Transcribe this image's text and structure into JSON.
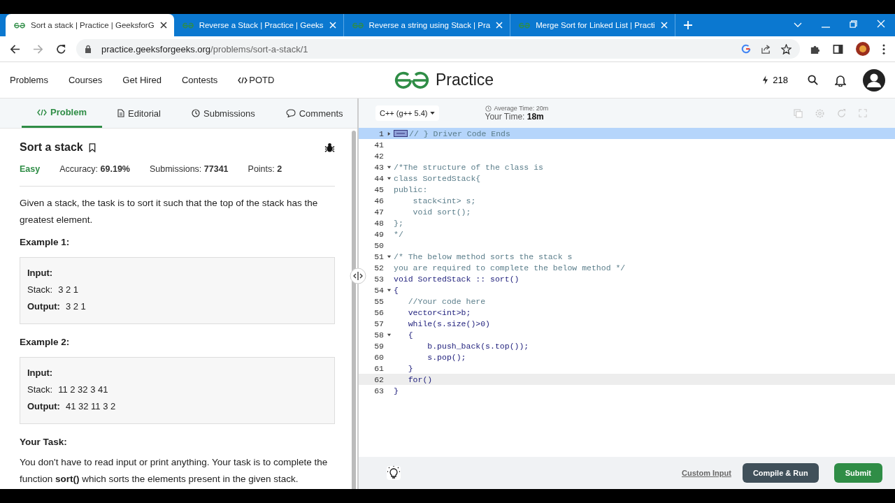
{
  "browser": {
    "tabs": [
      {
        "title": "Sort a stack | Practice | GeeksforG",
        "selected": true
      },
      {
        "title": "Reverse a Stack | Practice | Geeks",
        "selected": false
      },
      {
        "title": "Reverse a string using Stack | Pra",
        "selected": false
      },
      {
        "title": "Merge Sort for Linked List | Practi",
        "selected": false
      }
    ],
    "url": {
      "domain": "practice.geeksforgeeks.org",
      "path": "/problems/sort-a-stack/1"
    }
  },
  "site_nav": {
    "items": [
      "Problems",
      "Courses",
      "Get Hired",
      "Contests",
      "POTD"
    ],
    "logo": "Practice",
    "streak": "218"
  },
  "problem_tabs": [
    {
      "label": "Problem",
      "selected": true
    },
    {
      "label": "Editorial",
      "selected": false
    },
    {
      "label": "Submissions",
      "selected": false
    },
    {
      "label": "Comments",
      "selected": false
    }
  ],
  "problem": {
    "title": "Sort a stack",
    "difficulty": "Easy",
    "stats": [
      "Accuracy: **69.19%**",
      "Submissions: **77341**",
      "Points: **2**"
    ],
    "description": "Given a stack, the task is to sort it such that the top of the stack has the greatest element.",
    "examples": [
      {
        "title": "Example 1:",
        "lines": [
          {
            "label": "Input:"
          },
          {
            "label": "Stack:",
            "value": "3 2 1"
          },
          {
            "label": "Output:",
            "value": "3 2 1"
          }
        ]
      },
      {
        "title": "Example 2:",
        "lines": [
          {
            "label": "Input:"
          },
          {
            "label": "Stack:",
            "value": "11 2 32 3 41"
          },
          {
            "label": "Output:",
            "value": "41 32 11 3 2"
          }
        ]
      }
    ],
    "task_heading": "Your Task:",
    "task_text": "You don't have to read input or print anything. Your task is to complete the function **sort()** which sorts the elements present in the given stack."
  },
  "editor": {
    "language": "C++ (g++ 5.4)",
    "average_time": "Average Time: 20m",
    "your_time_label": "Your Time:",
    "your_time": "18m",
    "lines": [
      {
        "number": "1",
        "text": "// } Driver Code Ends",
        "kind": "comment",
        "foldable": true,
        "collapsed": true,
        "selected": true,
        "active": false
      },
      {
        "number": "41",
        "foldable": false,
        "collapsed": false,
        "selected": false,
        "active": false
      },
      {
        "number": "42",
        "foldable": false,
        "collapsed": false,
        "selected": false,
        "active": false
      },
      {
        "number": "43",
        "text": "/*The structure of the class is",
        "kind": "comment",
        "foldable": true,
        "collapsed": false,
        "selected": false,
        "active": false
      },
      {
        "number": "44",
        "text": "class SortedStack{",
        "kind": "comment",
        "foldable": true,
        "collapsed": false,
        "selected": false,
        "active": false
      },
      {
        "number": "45",
        "text": "public:",
        "kind": "comment",
        "foldable": false,
        "collapsed": false,
        "selected": false,
        "active": false
      },
      {
        "number": "46",
        "text": "    stack<int> s;",
        "kind": "comment",
        "foldable": false,
        "collapsed": false,
        "selected": false,
        "active": false
      },
      {
        "number": "47",
        "text": "    void sort();",
        "kind": "comment",
        "foldable": false,
        "collapsed": false,
        "selected": false,
        "active": false
      },
      {
        "number": "48",
        "text": "};",
        "kind": "comment",
        "foldable": false,
        "collapsed": false,
        "selected": false,
        "active": false
      },
      {
        "number": "49",
        "text": "*/",
        "kind": "comment",
        "foldable": false,
        "collapsed": false,
        "selected": false,
        "active": false
      },
      {
        "number": "50",
        "foldable": false,
        "collapsed": false,
        "selected": false,
        "active": false
      },
      {
        "number": "51",
        "text": "/* The below method sorts the stack s",
        "kind": "comment",
        "foldable": true,
        "collapsed": false,
        "selected": false,
        "active": false
      },
      {
        "number": "52",
        "text": "you are required to complete the below method */",
        "kind": "comment",
        "foldable": false,
        "collapsed": false,
        "selected": false,
        "active": false
      },
      {
        "number": "53",
        "text": "void SortedStack :: sort()",
        "kind": "code",
        "foldable": false,
        "collapsed": false,
        "selected": false,
        "active": false
      },
      {
        "number": "54",
        "text": "{",
        "kind": "code",
        "foldable": true,
        "collapsed": false,
        "selected": false,
        "active": false
      },
      {
        "number": "55",
        "text": "   //Your code here",
        "kind": "comment",
        "foldable": false,
        "collapsed": false,
        "selected": false,
        "active": false
      },
      {
        "number": "56",
        "text": "   vector<int>b;",
        "kind": "code",
        "foldable": false,
        "collapsed": false,
        "selected": false,
        "active": false
      },
      {
        "number": "57",
        "text": "   while(s.size()>0)",
        "kind": "code",
        "foldable": false,
        "collapsed": false,
        "selected": false,
        "active": false
      },
      {
        "number": "58",
        "text": "   {",
        "kind": "code",
        "foldable": true,
        "collapsed": false,
        "selected": false,
        "active": false
      },
      {
        "number": "59",
        "text": "       b.push_back(s.top());",
        "kind": "code",
        "foldable": false,
        "collapsed": false,
        "selected": false,
        "active": false
      },
      {
        "number": "60",
        "text": "       s.pop();",
        "kind": "code",
        "foldable": false,
        "collapsed": false,
        "selected": false,
        "active": false
      },
      {
        "number": "61",
        "text": "   }",
        "kind": "code",
        "foldable": false,
        "collapsed": false,
        "selected": false,
        "active": false
      },
      {
        "number": "62",
        "text": "   for()",
        "kind": "code",
        "foldable": false,
        "collapsed": false,
        "selected": false,
        "active": true
      },
      {
        "number": "63",
        "text": "}",
        "kind": "code",
        "foldable": false,
        "collapsed": false,
        "selected": false,
        "active": false
      }
    ],
    "custom_input": "Custom Input",
    "compile_button": "Compile & Run",
    "submit_button": "Submit"
  }
}
